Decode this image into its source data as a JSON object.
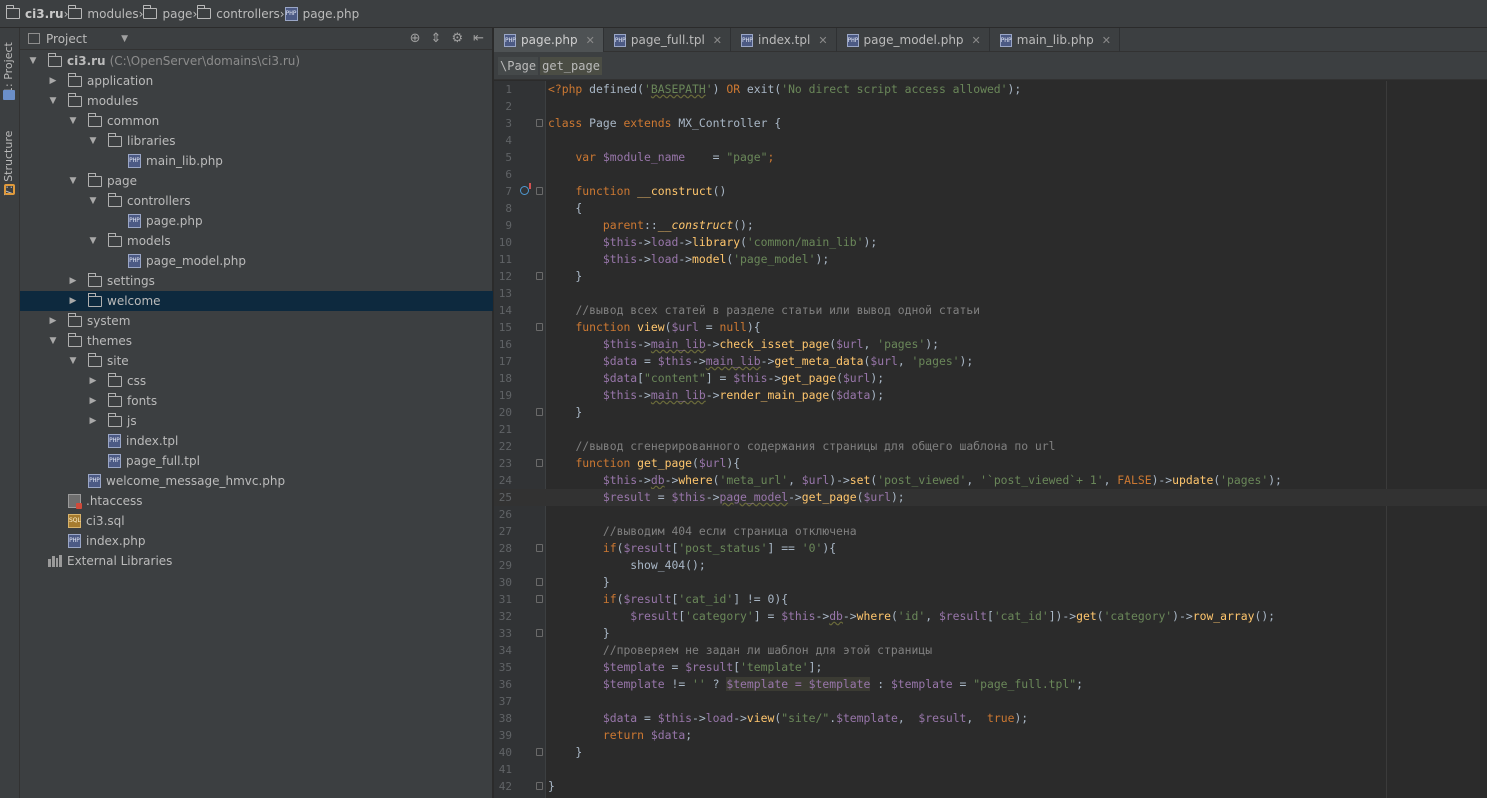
{
  "breadcrumb": [
    "ci3.ru",
    "modules",
    "page",
    "controllers",
    "page.php"
  ],
  "toolstrip": {
    "project_label": "1: Project",
    "structure_label": "7: Structure"
  },
  "project_panel": {
    "title": "Project",
    "tree": [
      {
        "level": 0,
        "type": "folder",
        "expanded": true,
        "label": "ci3.ru",
        "extra": "(C:\\OpenServer\\domains\\ci3.ru)"
      },
      {
        "level": 1,
        "type": "folder",
        "expanded": false,
        "label": "application"
      },
      {
        "level": 1,
        "type": "folder",
        "expanded": true,
        "label": "modules"
      },
      {
        "level": 2,
        "type": "folder",
        "expanded": true,
        "label": "common"
      },
      {
        "level": 3,
        "type": "folder",
        "expanded": true,
        "label": "libraries"
      },
      {
        "level": 4,
        "type": "php",
        "label": "main_lib.php"
      },
      {
        "level": 2,
        "type": "folder",
        "expanded": true,
        "label": "page"
      },
      {
        "level": 3,
        "type": "folder",
        "expanded": true,
        "label": "controllers"
      },
      {
        "level": 4,
        "type": "php",
        "label": "page.php"
      },
      {
        "level": 3,
        "type": "folder",
        "expanded": true,
        "label": "models"
      },
      {
        "level": 4,
        "type": "php",
        "label": "page_model.php"
      },
      {
        "level": 2,
        "type": "folder",
        "expanded": false,
        "label": "settings"
      },
      {
        "level": 2,
        "type": "folder",
        "expanded": false,
        "label": "welcome",
        "selected": true
      },
      {
        "level": 1,
        "type": "folder",
        "expanded": false,
        "label": "system"
      },
      {
        "level": 1,
        "type": "folder",
        "expanded": true,
        "label": "themes"
      },
      {
        "level": 2,
        "type": "folder",
        "expanded": true,
        "label": "site"
      },
      {
        "level": 3,
        "type": "folder",
        "expanded": false,
        "label": "css"
      },
      {
        "level": 3,
        "type": "folder",
        "expanded": false,
        "label": "fonts"
      },
      {
        "level": 3,
        "type": "folder",
        "expanded": false,
        "label": "js"
      },
      {
        "level": 3,
        "type": "php",
        "label": "index.tpl"
      },
      {
        "level": 3,
        "type": "php",
        "label": "page_full.tpl"
      },
      {
        "level": 2,
        "type": "php",
        "label": "welcome_message_hmvc.php"
      },
      {
        "level": 1,
        "type": "htaccess",
        "label": ".htaccess"
      },
      {
        "level": 1,
        "type": "sql",
        "label": "ci3.sql"
      },
      {
        "level": 1,
        "type": "php",
        "label": "index.php"
      },
      {
        "level": 0,
        "type": "lib",
        "label": "External Libraries"
      }
    ]
  },
  "tabs": [
    {
      "label": "page.php",
      "active": true
    },
    {
      "label": "page_full.tpl",
      "active": false
    },
    {
      "label": "index.tpl",
      "active": false
    },
    {
      "label": "page_model.php",
      "active": false
    },
    {
      "label": "main_lib.php",
      "active": false
    }
  ],
  "navbar": {
    "class": "\\Page",
    "method": "get_page"
  },
  "editor": {
    "current_line": 25,
    "lines": [
      [
        [
          "kw",
          "<?php "
        ],
        [
          "t",
          "defined("
        ],
        [
          "str",
          "'"
        ],
        [
          "strund",
          "BASEPATH"
        ],
        [
          "str",
          "'"
        ],
        [
          "t",
          ") "
        ],
        [
          "kw",
          "OR "
        ],
        [
          "t",
          "exit("
        ],
        [
          "str",
          "'No direct script access allowed'"
        ],
        [
          "t",
          ");"
        ]
      ],
      [],
      [
        [
          "kw",
          "class "
        ],
        [
          "t",
          "Page "
        ],
        [
          "kw",
          "extends "
        ],
        [
          "t",
          "MX_Controller {"
        ]
      ],
      [],
      [
        [
          "t",
          "    "
        ],
        [
          "kw",
          "var "
        ],
        [
          "var",
          "$module_name"
        ],
        [
          "t",
          "    = "
        ],
        [
          "str",
          "\"page\""
        ],
        [
          "kw",
          ";"
        ]
      ],
      [],
      [
        [
          "t",
          "    "
        ],
        [
          "kw",
          "function "
        ],
        [
          "fn",
          "__construct"
        ],
        [
          "t",
          "()"
        ]
      ],
      [
        [
          "t",
          "    {"
        ]
      ],
      [
        [
          "t",
          "        "
        ],
        [
          "kw",
          "parent"
        ],
        [
          "t",
          "::"
        ],
        [
          "fni",
          "__construct"
        ],
        [
          "t",
          "();"
        ]
      ],
      [
        [
          "t",
          "        "
        ],
        [
          "var",
          "$this"
        ],
        [
          "t",
          "->"
        ],
        [
          "var",
          "load"
        ],
        [
          "t",
          "->"
        ],
        [
          "fn",
          "library"
        ],
        [
          "t",
          "("
        ],
        [
          "str",
          "'common/main_lib'"
        ],
        [
          "t",
          ");"
        ]
      ],
      [
        [
          "t",
          "        "
        ],
        [
          "var",
          "$this"
        ],
        [
          "t",
          "->"
        ],
        [
          "var",
          "load"
        ],
        [
          "t",
          "->"
        ],
        [
          "fn",
          "model"
        ],
        [
          "t",
          "("
        ],
        [
          "str",
          "'page_model'"
        ],
        [
          "t",
          ");"
        ]
      ],
      [
        [
          "t",
          "    }"
        ]
      ],
      [],
      [
        [
          "t",
          "    "
        ],
        [
          "cm",
          "//вывод всех статей в разделе статьи или вывод одной статьи"
        ]
      ],
      [
        [
          "t",
          "    "
        ],
        [
          "kw",
          "function "
        ],
        [
          "fn",
          "view"
        ],
        [
          "t",
          "("
        ],
        [
          "var",
          "$url"
        ],
        [
          "t",
          " = "
        ],
        [
          "kw",
          "null"
        ],
        [
          "t",
          "){"
        ]
      ],
      [
        [
          "t",
          "        "
        ],
        [
          "var",
          "$this"
        ],
        [
          "t",
          "->"
        ],
        [
          "varund",
          "main_lib"
        ],
        [
          "t",
          "->"
        ],
        [
          "fn",
          "check_isset_page"
        ],
        [
          "t",
          "("
        ],
        [
          "var",
          "$url"
        ],
        [
          "t",
          ", "
        ],
        [
          "str",
          "'pages'"
        ],
        [
          "t",
          ");"
        ]
      ],
      [
        [
          "t",
          "        "
        ],
        [
          "var",
          "$data"
        ],
        [
          "t",
          " = "
        ],
        [
          "var",
          "$this"
        ],
        [
          "t",
          "->"
        ],
        [
          "varund",
          "main_lib"
        ],
        [
          "t",
          "->"
        ],
        [
          "fn",
          "get_meta_data"
        ],
        [
          "t",
          "("
        ],
        [
          "var",
          "$url"
        ],
        [
          "t",
          ", "
        ],
        [
          "str",
          "'pages'"
        ],
        [
          "t",
          ");"
        ]
      ],
      [
        [
          "t",
          "        "
        ],
        [
          "var",
          "$data"
        ],
        [
          "t",
          "["
        ],
        [
          "str",
          "\"content\""
        ],
        [
          "t",
          "] = "
        ],
        [
          "var",
          "$this"
        ],
        [
          "t",
          "->"
        ],
        [
          "fn",
          "get_page"
        ],
        [
          "t",
          "("
        ],
        [
          "var",
          "$url"
        ],
        [
          "t",
          ");"
        ]
      ],
      [
        [
          "t",
          "        "
        ],
        [
          "var",
          "$this"
        ],
        [
          "t",
          "->"
        ],
        [
          "varund",
          "main_lib"
        ],
        [
          "t",
          "->"
        ],
        [
          "fn",
          "render_main_page"
        ],
        [
          "t",
          "("
        ],
        [
          "var",
          "$data"
        ],
        [
          "t",
          ");"
        ]
      ],
      [
        [
          "t",
          "    }"
        ]
      ],
      [],
      [
        [
          "t",
          "    "
        ],
        [
          "cm",
          "//вывод сгенерированного содержания страницы для общего шаблона по url"
        ]
      ],
      [
        [
          "t",
          "    "
        ],
        [
          "kw",
          "function "
        ],
        [
          "fn",
          "get_page"
        ],
        [
          "t",
          "("
        ],
        [
          "var",
          "$url"
        ],
        [
          "t",
          "){"
        ]
      ],
      [
        [
          "t",
          "        "
        ],
        [
          "var",
          "$this"
        ],
        [
          "t",
          "->"
        ],
        [
          "varund",
          "db"
        ],
        [
          "t",
          "->"
        ],
        [
          "fn",
          "where"
        ],
        [
          "t",
          "("
        ],
        [
          "str",
          "'meta_url'"
        ],
        [
          "t",
          ", "
        ],
        [
          "var",
          "$url"
        ],
        [
          "t",
          ")->"
        ],
        [
          "fn",
          "set"
        ],
        [
          "t",
          "("
        ],
        [
          "str",
          "'post_viewed'"
        ],
        [
          "t",
          ", "
        ],
        [
          "str",
          "'`post_viewed`+ 1'"
        ],
        [
          "t",
          ", "
        ],
        [
          "kw",
          "FALSE"
        ],
        [
          "t",
          ")->"
        ],
        [
          "fn",
          "update"
        ],
        [
          "t",
          "("
        ],
        [
          "str",
          "'pages'"
        ],
        [
          "t",
          ");"
        ]
      ],
      [
        [
          "t",
          "        "
        ],
        [
          "var",
          "$result"
        ],
        [
          "t",
          " = "
        ],
        [
          "var",
          "$this"
        ],
        [
          "t",
          "->"
        ],
        [
          "varund",
          "page_model"
        ],
        [
          "t",
          "->"
        ],
        [
          "fn",
          "get_page"
        ],
        [
          "t",
          "("
        ],
        [
          "var",
          "$url"
        ],
        [
          "t",
          ");"
        ]
      ],
      [],
      [
        [
          "t",
          "        "
        ],
        [
          "cm",
          "//выводим 404 если страница отключена"
        ]
      ],
      [
        [
          "t",
          "        "
        ],
        [
          "kw",
          "if"
        ],
        [
          "t",
          "("
        ],
        [
          "var",
          "$result"
        ],
        [
          "t",
          "["
        ],
        [
          "str",
          "'post_status'"
        ],
        [
          "t",
          "] == "
        ],
        [
          "str",
          "'0'"
        ],
        [
          "t",
          "){"
        ]
      ],
      [
        [
          "t",
          "            show_404();"
        ]
      ],
      [
        [
          "t",
          "        }"
        ]
      ],
      [
        [
          "t",
          "        "
        ],
        [
          "kw",
          "if"
        ],
        [
          "t",
          "("
        ],
        [
          "var",
          "$result"
        ],
        [
          "t",
          "["
        ],
        [
          "str",
          "'cat_id'"
        ],
        [
          "t",
          "] != 0){"
        ]
      ],
      [
        [
          "t",
          "            "
        ],
        [
          "var",
          "$result"
        ],
        [
          "t",
          "["
        ],
        [
          "str",
          "'category'"
        ],
        [
          "t",
          "] = "
        ],
        [
          "var",
          "$this"
        ],
        [
          "t",
          "->"
        ],
        [
          "varund",
          "db"
        ],
        [
          "t",
          "->"
        ],
        [
          "fn",
          "where"
        ],
        [
          "t",
          "("
        ],
        [
          "str",
          "'id'"
        ],
        [
          "t",
          ", "
        ],
        [
          "var",
          "$result"
        ],
        [
          "t",
          "["
        ],
        [
          "str",
          "'cat_id'"
        ],
        [
          "t",
          "])->"
        ],
        [
          "fn",
          "get"
        ],
        [
          "t",
          "("
        ],
        [
          "str",
          "'category'"
        ],
        [
          "t",
          ")->"
        ],
        [
          "fn",
          "row_array"
        ],
        [
          "t",
          "();"
        ]
      ],
      [
        [
          "t",
          "        }"
        ]
      ],
      [
        [
          "t",
          "        "
        ],
        [
          "cm",
          "//проверяем не задан ли шаблон для этой страницы"
        ]
      ],
      [
        [
          "t",
          "        "
        ],
        [
          "var",
          "$template"
        ],
        [
          "t",
          " = "
        ],
        [
          "var",
          "$result"
        ],
        [
          "t",
          "["
        ],
        [
          "str",
          "'template'"
        ],
        [
          "t",
          "];"
        ]
      ],
      [
        [
          "t",
          "        "
        ],
        [
          "var",
          "$template"
        ],
        [
          "t",
          " != "
        ],
        [
          "str",
          "''"
        ],
        [
          "t",
          " ? "
        ],
        [
          "varhl",
          "$template = $template"
        ],
        [
          "t",
          " : "
        ],
        [
          "var",
          "$template"
        ],
        [
          "t",
          " = "
        ],
        [
          "str",
          "\"page_full.tpl\""
        ],
        [
          "t",
          ";"
        ]
      ],
      [],
      [
        [
          "t",
          "        "
        ],
        [
          "var",
          "$data"
        ],
        [
          "t",
          " = "
        ],
        [
          "var",
          "$this"
        ],
        [
          "t",
          "->"
        ],
        [
          "var",
          "load"
        ],
        [
          "t",
          "->"
        ],
        [
          "fn",
          "view"
        ],
        [
          "t",
          "("
        ],
        [
          "str",
          "\"site/\""
        ],
        [
          "t",
          "."
        ],
        [
          "var",
          "$template"
        ],
        [
          "t",
          ",  "
        ],
        [
          "var",
          "$result"
        ],
        [
          "t",
          ",  "
        ],
        [
          "kw",
          "true"
        ],
        [
          "t",
          ");"
        ]
      ],
      [
        [
          "t",
          "        "
        ],
        [
          "kw",
          "return "
        ],
        [
          "var",
          "$data"
        ],
        [
          "t",
          ";"
        ]
      ],
      [
        [
          "t",
          "    }"
        ]
      ],
      [],
      [
        [
          "t",
          "}"
        ]
      ]
    ]
  },
  "colors": {
    "keyword": "#cc7832",
    "string": "#6a8759",
    "variable": "#9876aa",
    "function": "#ffc66d",
    "comment": "#808080",
    "default": "#a9b7c6",
    "selection": "#0d293e"
  }
}
